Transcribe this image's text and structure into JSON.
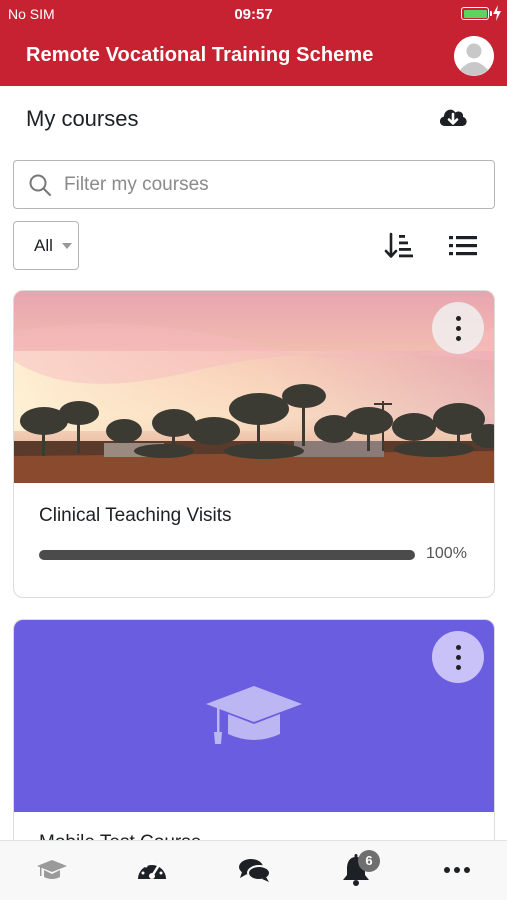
{
  "status": {
    "carrier": "No SIM",
    "time": "09:57"
  },
  "app": {
    "title": "Remote Vocational Training Scheme",
    "avatar_icon": "user-avatar-icon"
  },
  "header": {
    "title": "My courses",
    "download_icon": "cloud-download-icon"
  },
  "search": {
    "placeholder": "Filter my courses",
    "value": ""
  },
  "filter": {
    "selected": "All"
  },
  "view_controls": {
    "sort_icon": "sort-icon",
    "list_icon": "list-view-icon"
  },
  "courses": [
    {
      "title": "Clinical Teaching Visits",
      "progress_label": "100%",
      "progress_value": 100,
      "image": "outback landscape at sunset"
    },
    {
      "title": "Mobile Test Course",
      "image_color": "#6a5de0",
      "image": "graduation-cap-icon"
    }
  ],
  "tabs": [
    {
      "name": "my-courses-tab",
      "icon": "graduation-cap-icon"
    },
    {
      "name": "dashboard-tab",
      "icon": "gauge-icon"
    },
    {
      "name": "messages-tab",
      "icon": "chat-bubbles-icon"
    },
    {
      "name": "notifications-tab",
      "icon": "bell-icon",
      "badge": "6"
    },
    {
      "name": "more-tab",
      "icon": "more-dots-icon"
    }
  ],
  "colors": {
    "brand": "#c62232",
    "progress": "#4b4b4b",
    "placeholder_course": "#6a5de0"
  }
}
